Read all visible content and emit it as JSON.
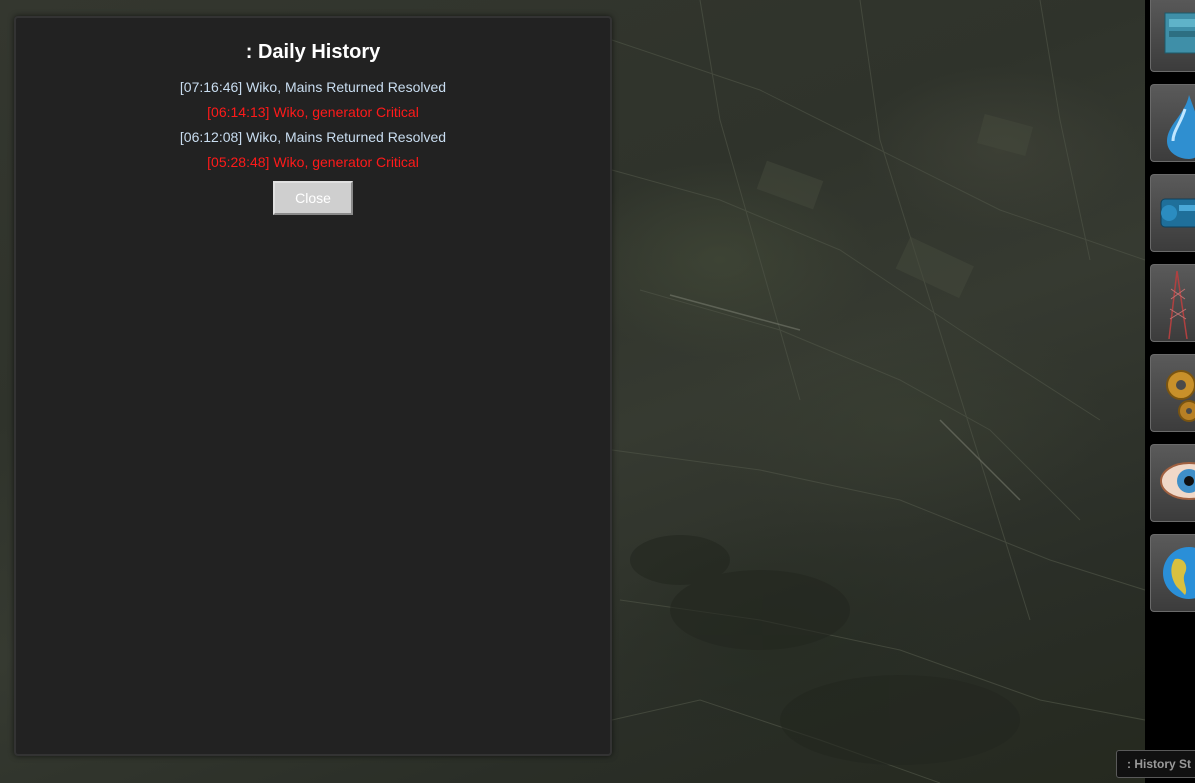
{
  "dialog": {
    "title": ": Daily History",
    "entries": [
      {
        "text": "[07:16:46] Wiko, Mains Returned Resolved",
        "status": "resolved"
      },
      {
        "text": "[06:14:13] Wiko, generator Critical",
        "status": "critical"
      },
      {
        "text": "[06:12:08] Wiko, Mains Returned Resolved",
        "status": "resolved"
      },
      {
        "text": "[05:28:48] Wiko, generator Critical",
        "status": "critical"
      }
    ],
    "close_label": "Close"
  },
  "toolbar": {
    "buttons": [
      {
        "icon": "generator-icon"
      },
      {
        "icon": "water-drop-icon"
      },
      {
        "icon": "pump-icon"
      },
      {
        "icon": "tower-icon"
      },
      {
        "icon": "gears-icon"
      },
      {
        "icon": "eye-icon"
      },
      {
        "icon": "globe-icon"
      }
    ]
  },
  "status_tab": {
    "label": ": History St"
  },
  "colors": {
    "resolved": "#c9ddf0",
    "critical": "#ff1a1a",
    "dialog_bg": "#222222"
  }
}
